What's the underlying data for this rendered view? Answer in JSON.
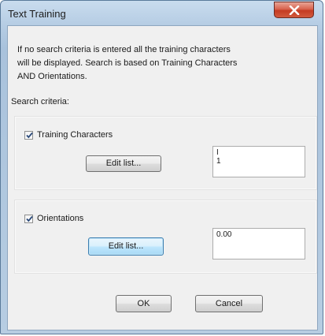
{
  "window": {
    "title": "Text Training",
    "close_icon": "close-icon"
  },
  "info": {
    "lines": [
      "If no search criteria is entered all the training characters",
      "will be displayed.  Search is based on Training Characters",
      "AND Orientations."
    ]
  },
  "search_criteria_label": "Search criteria:",
  "training_characters": {
    "label": "Training Characters",
    "checked": true,
    "edit_button": "Edit list...",
    "items": [
      "I",
      "1"
    ]
  },
  "orientations": {
    "label": "Orientations",
    "checked": true,
    "edit_button": "Edit list...",
    "items": [
      "0.00"
    ]
  },
  "buttons": {
    "ok": "OK",
    "cancel": "Cancel"
  },
  "colors": {
    "title_bar": "#b6cde4",
    "close_button": "#c43b22",
    "focus_button": "#a7d9f5"
  }
}
